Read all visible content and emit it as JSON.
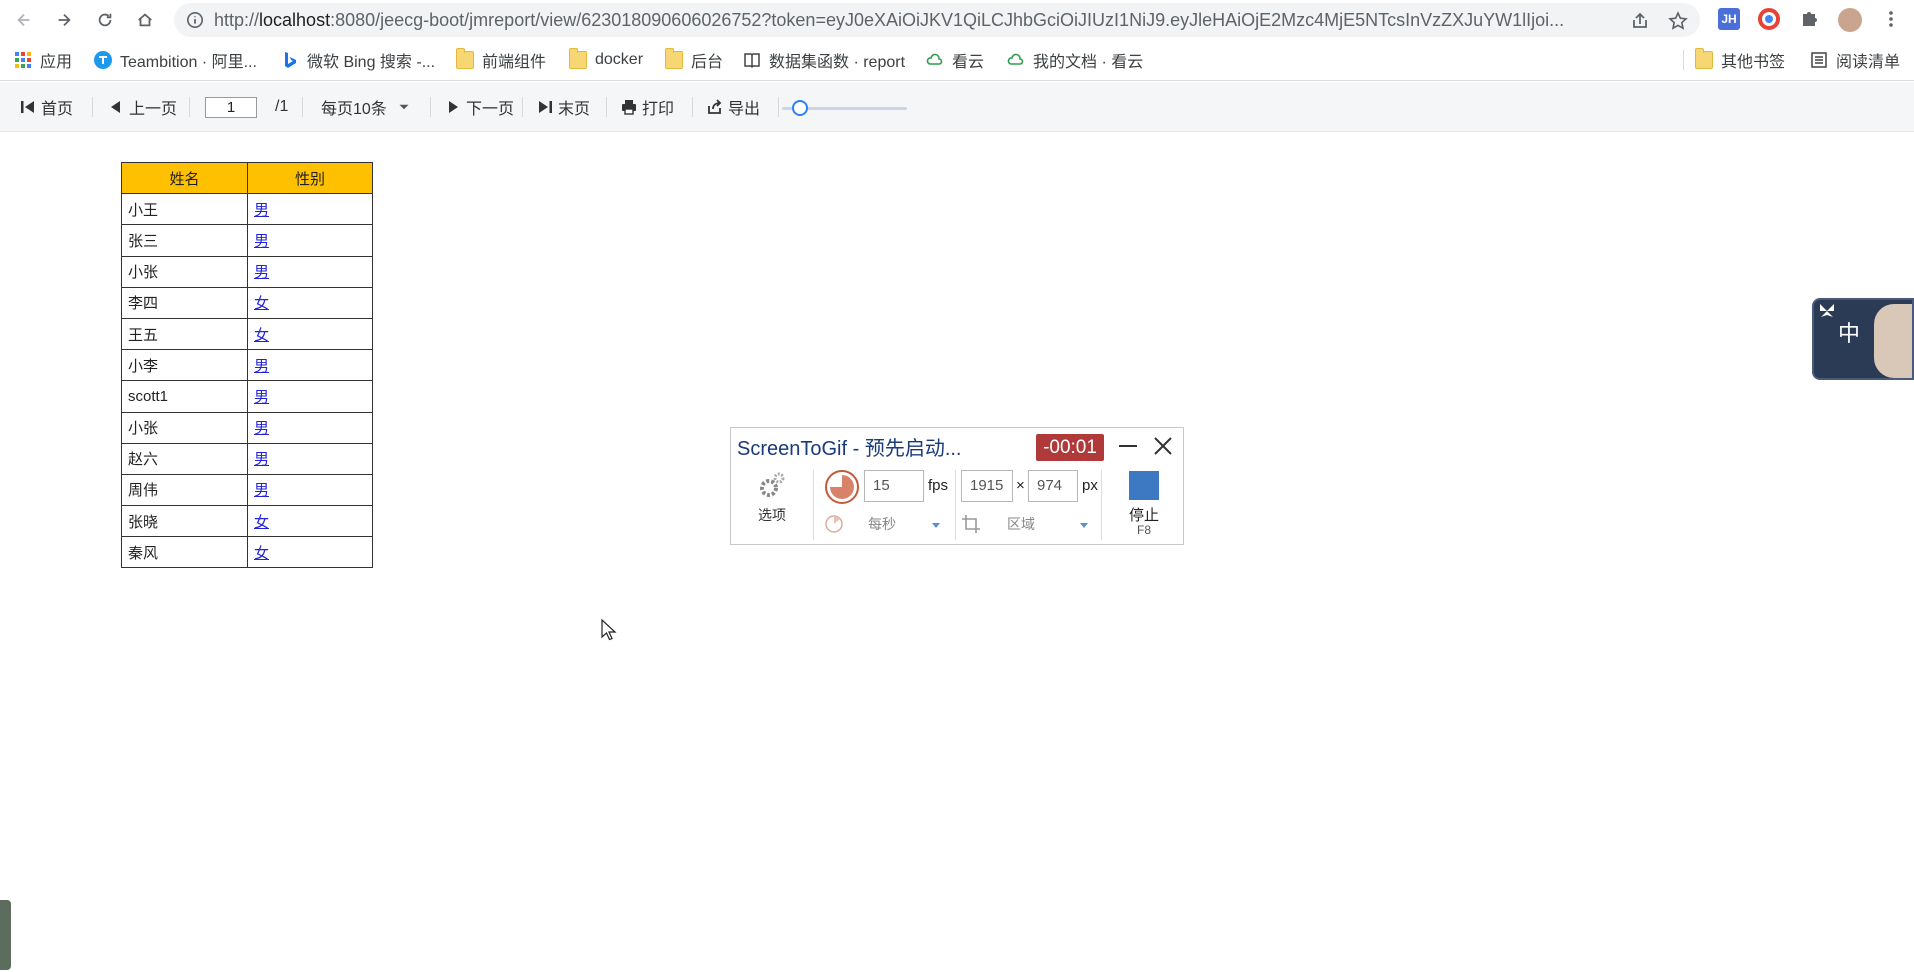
{
  "browser": {
    "url_prefix": "http://",
    "url_host": "localhost",
    "url_rest": ":8080/jeecg-boot/jmreport/view/623018090606026752?token=eyJ0eXAiOiJKV1QiLCJhbGciOiJIUzI1NiJ9.eyJleHAiOjE2Mzc4MjE5NTcsInVzZXJuYW1lIjoi...",
    "bookmarks": [
      "应用",
      "Teambition · 阿里...",
      "微软 Bing 搜索 -...",
      "前端组件",
      "docker",
      "后台",
      "数据集函数 · report",
      "看云",
      "我的文档 · 看云"
    ],
    "bookmarks_right": [
      "其他书签",
      "阅读清单"
    ],
    "profile_badge": "JH"
  },
  "toolbar": {
    "first": "首页",
    "prev": "上一页",
    "page_value": "1",
    "page_total": "/1",
    "page_size": "每页10条",
    "next": "下一页",
    "last": "末页",
    "print": "打印",
    "export": "导出"
  },
  "table": {
    "headers": [
      "姓名",
      "性别"
    ],
    "rows": [
      [
        "小王",
        "男"
      ],
      [
        "张三",
        "男"
      ],
      [
        "小张",
        "男"
      ],
      [
        "李四",
        "女"
      ],
      [
        "王五",
        "女"
      ],
      [
        "小李",
        "男"
      ],
      [
        "scott1",
        "男"
      ],
      [
        "小张",
        "男"
      ],
      [
        "赵六",
        "男"
      ],
      [
        "周伟",
        "男"
      ],
      [
        "张晓",
        "女"
      ],
      [
        "秦风",
        "女"
      ]
    ],
    "colors": {
      "header_bg": "#ffc000",
      "link": "#2222dd"
    }
  },
  "screentogif": {
    "title": "ScreenToGif - 预先启动...",
    "timer": "-00:01",
    "options": "选项",
    "fps_value": "15",
    "fps_unit": "fps",
    "width": "1915",
    "times": "×",
    "height": "974",
    "px_unit": "px",
    "per_second": "每秒",
    "region": "区域",
    "stop": "停止",
    "stop_key": "F8"
  },
  "ime": {
    "mode": "中"
  }
}
